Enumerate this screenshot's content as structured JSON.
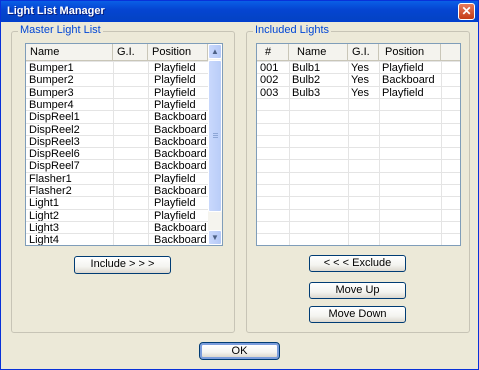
{
  "window": {
    "title": "Light List Manager",
    "close_glyph": "✕"
  },
  "master": {
    "group_title": "Master Light List",
    "headers": [
      "Name",
      "G.I.",
      "Position"
    ],
    "rows": [
      [
        "Bumper1",
        "",
        "Playfield"
      ],
      [
        "Bumper2",
        "",
        "Playfield"
      ],
      [
        "Bumper3",
        "",
        "Playfield"
      ],
      [
        "Bumper4",
        "",
        "Playfield"
      ],
      [
        "DispReel1",
        "",
        "Backboard"
      ],
      [
        "DispReel2",
        "",
        "Backboard"
      ],
      [
        "DispReel3",
        "",
        "Backboard"
      ],
      [
        "DispReel6",
        "",
        "Backboard"
      ],
      [
        "DispReel7",
        "",
        "Backboard"
      ],
      [
        "Flasher1",
        "",
        "Playfield"
      ],
      [
        "Flasher2",
        "",
        "Backboard"
      ],
      [
        "Light1",
        "",
        "Playfield"
      ],
      [
        "Light2",
        "",
        "Playfield"
      ],
      [
        "Light3",
        "",
        "Backboard"
      ],
      [
        "Light4",
        "",
        "Backboard"
      ]
    ],
    "include_label": "Include > > >"
  },
  "included": {
    "group_title": "Included Lights",
    "headers": [
      "#",
      "Name",
      "G.I.",
      "Position"
    ],
    "rows": [
      [
        "001",
        "Bulb1",
        "Yes",
        "Playfield"
      ],
      [
        "002",
        "Bulb2",
        "Yes",
        "Backboard"
      ],
      [
        "003",
        "Bulb3",
        "Yes",
        "Playfield"
      ]
    ],
    "exclude_label": "< < < Exclude",
    "move_up_label": "Move Up",
    "move_down_label": "Move Down"
  },
  "ok_label": "OK",
  "icons": {
    "scroll_up": "scroll-up-arrow-icon",
    "scroll_down": "scroll-down-arrow-icon",
    "close": "close-icon"
  }
}
